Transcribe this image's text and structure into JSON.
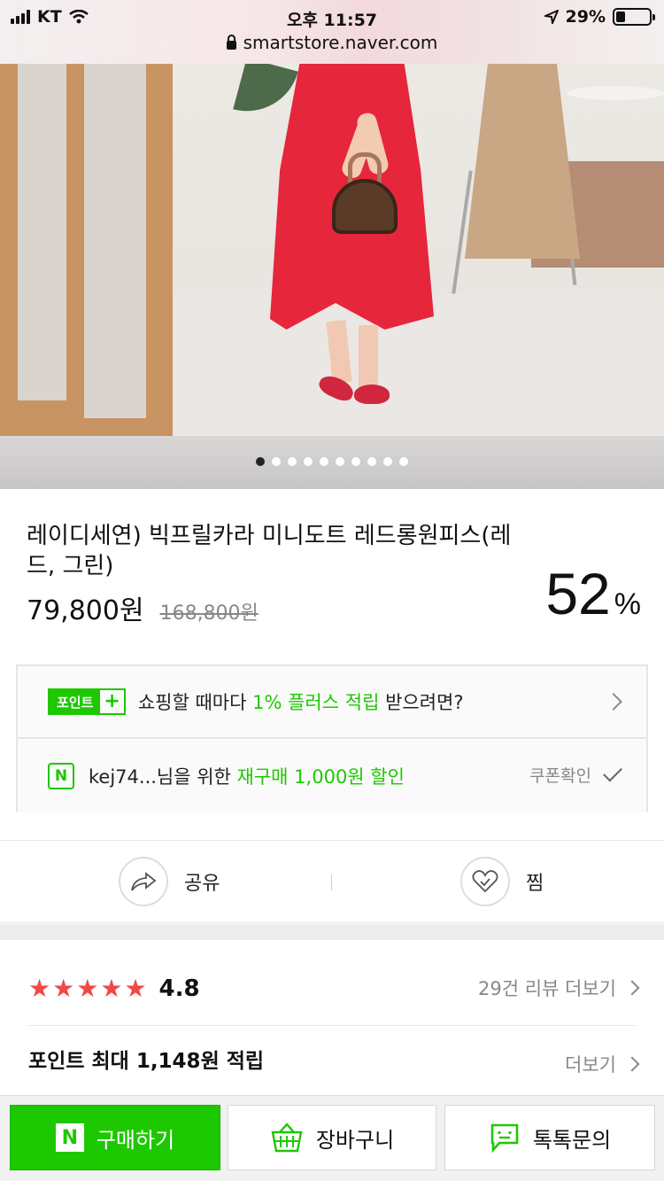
{
  "status_bar": {
    "carrier": "KT",
    "time": "오후 11:57",
    "battery": "29%",
    "battery_level": 0.29,
    "url": "smartstore.naver.com"
  },
  "gallery": {
    "total_images": 10,
    "current_index": 1
  },
  "product": {
    "title": "레이디세연) 빅프릴카라 미니도트 레드롱원피스(레드, 그린)",
    "price": "79,800원",
    "original_price": "168,800원",
    "discount_value": "52",
    "discount_unit": "%"
  },
  "benefits": {
    "point_badge_label": "포인트",
    "point_badge_plus": "+",
    "point_text_before": "쇼핑할 때마다 ",
    "point_text_highlight": "1% 플러스 적립",
    "point_text_after": " 받으려면?",
    "coupon_icon": "N",
    "coupon_text_before": "kej74...님을 위한 ",
    "coupon_text_highlight": "재구매 1,000원 할인",
    "coupon_action": "쿠폰확인"
  },
  "actions": {
    "share_label": "공유",
    "wish_label": "찜"
  },
  "reviews": {
    "stars": 5,
    "rating": "4.8",
    "review_link": "29건 리뷰 더보기"
  },
  "points": {
    "text": "포인트 최대 1,148원 적립",
    "more_label": "더보기"
  },
  "bottom_bar": {
    "buy_icon": "N",
    "buy_label": "구매하기",
    "cart_label": "장바구니",
    "talk_label": "톡톡문의"
  },
  "colors": {
    "naver_green": "#1ec800",
    "star_red": "#f04848",
    "dress_red": "#e6263b"
  },
  "icons": [
    "location-arrow-icon",
    "lock-icon",
    "wifi-icon",
    "chevron-right-icon",
    "share-arrow-icon",
    "heart-icon",
    "check-icon",
    "basket-icon",
    "talk-bubble-icon"
  ]
}
